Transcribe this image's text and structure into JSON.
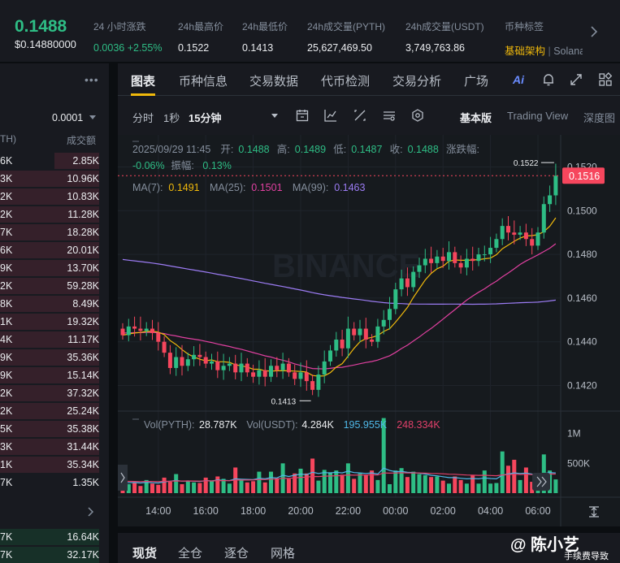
{
  "ticker": {
    "last_price": "0.1488",
    "fiat_price": "$0.14880000",
    "stats": [
      {
        "label": "24 小时涨跌",
        "value": "0.0036 +2.55%",
        "up": true
      },
      {
        "label": "24h最高价",
        "value": "0.1522"
      },
      {
        "label": "24h最低价",
        "value": "0.1413"
      },
      {
        "label": "24h成交量(PYTH)",
        "value": "25,627,469.50"
      },
      {
        "label": "24h成交量(USDT)",
        "value": "3,749,763.86"
      }
    ],
    "tag_label": "币种标签",
    "tag_value": "基础架构",
    "tag_sep": " | ",
    "tag_rest": "Solana"
  },
  "orderbook": {
    "precision": "0.0001",
    "col_left": "TH)",
    "col_right": "成交额",
    "rows": [
      {
        "a": "6K",
        "b": "2.85K",
        "fill": 0.45,
        "side": "ask"
      },
      {
        "a": "3K",
        "b": "10.96K",
        "fill": 1.0,
        "side": "ask"
      },
      {
        "a": "2K",
        "b": "10.83K",
        "fill": 1.0,
        "side": "ask"
      },
      {
        "a": "2K",
        "b": "11.28K",
        "fill": 1.0,
        "side": "ask"
      },
      {
        "a": "7K",
        "b": "18.28K",
        "fill": 1.0,
        "side": "ask"
      },
      {
        "a": "6K",
        "b": "20.01K",
        "fill": 1.0,
        "side": "ask"
      },
      {
        "a": "9K",
        "b": "13.70K",
        "fill": 1.0,
        "side": "ask"
      },
      {
        "a": "2K",
        "b": "59.28K",
        "fill": 1.0,
        "side": "ask"
      },
      {
        "a": "8K",
        "b": "8.49K",
        "fill": 1.0,
        "side": "ask"
      },
      {
        "a": "1K",
        "b": "19.32K",
        "fill": 1.0,
        "side": "ask"
      },
      {
        "a": "4K",
        "b": "11.17K",
        "fill": 1.0,
        "side": "ask"
      },
      {
        "a": "9K",
        "b": "35.36K",
        "fill": 1.0,
        "side": "ask"
      },
      {
        "a": "9K",
        "b": "15.14K",
        "fill": 1.0,
        "side": "ask"
      },
      {
        "a": "2K",
        "b": "37.32K",
        "fill": 1.0,
        "side": "ask"
      },
      {
        "a": "2K",
        "b": "25.24K",
        "fill": 1.0,
        "side": "ask"
      },
      {
        "a": "5K",
        "b": "35.38K",
        "fill": 1.0,
        "side": "ask"
      },
      {
        "a": "3K",
        "b": "31.44K",
        "fill": 1.0,
        "side": "ask"
      },
      {
        "a": "1K",
        "b": "35.34K",
        "fill": 1.0,
        "side": "ask"
      },
      {
        "a": "7K",
        "b": "1.35K",
        "fill": 0.0,
        "side": "ask"
      }
    ],
    "bid_rows": [
      {
        "a": "7K",
        "b": "16.64K",
        "fill": 1.0,
        "side": "bid"
      },
      {
        "a": "7K",
        "b": "32.17K",
        "fill": 1.0,
        "side": "bid"
      }
    ]
  },
  "tabs": [
    {
      "label": "图表",
      "active": true
    },
    {
      "label": "币种信息"
    },
    {
      "label": "交易数据"
    },
    {
      "label": "代币检测"
    },
    {
      "label": "交易分析"
    },
    {
      "label": "广场"
    }
  ],
  "ai_label": "Ai",
  "toolbar": {
    "time_label": "分时",
    "sec_label": "1秒",
    "interval_label": "15分钟",
    "basic_label": "基本版",
    "tv_label": "Trading View",
    "depth_label": "深度图"
  },
  "chart_data": {
    "type": "candlestick",
    "info_line1": {
      "datetime": "2025/09/29 11:45",
      "open_label": "开:",
      "open": "0.1488",
      "high_label": "高:",
      "high": "0.1489",
      "low_label": "低:",
      "low": "0.1487",
      "close_label": "收:",
      "close": "0.1488",
      "chg_label": "涨跌幅:"
    },
    "info_line2": {
      "chg": "-0.06%",
      "amp_label": "振幅:",
      "amp": "0.13%"
    },
    "ma_legend": [
      {
        "label": "MA(7):",
        "value": "0.1491",
        "color": "#f0b90b"
      },
      {
        "label": "MA(25):",
        "value": "0.1501",
        "color": "#e040a0"
      },
      {
        "label": "MA(99):",
        "value": "0.1463",
        "color": "#9c7cf4"
      }
    ],
    "y_ticks": [
      "0.1520",
      "0.1500",
      "0.1480",
      "0.1460",
      "0.1440",
      "0.1420"
    ],
    "y_tick_values": [
      0.152,
      0.15,
      0.148,
      0.146,
      0.144,
      0.142
    ],
    "ylim": [
      0.1412,
      0.1528
    ],
    "current_price": "0.1516",
    "current_price_value": 0.1516,
    "high_marker": "0.1522",
    "low_marker": "0.1413",
    "x_ticks": [
      "14:00",
      "16:00",
      "18:00",
      "20:00",
      "22:00",
      "00:00",
      "02:00",
      "04:00",
      "06:00"
    ],
    "x_tick_index": [
      6,
      14,
      22,
      30,
      38,
      46,
      54,
      62,
      70
    ],
    "colors": {
      "up": "#2ebd85",
      "down": "#f6465d",
      "ma7": "#f0b90b",
      "ma25": "#e040a0",
      "ma99": "#9c7cf4",
      "vol_ma1": "#4fb8e8",
      "vol_ma2": "#e0406a"
    },
    "closes": [
      0.1443,
      0.1447,
      0.1446,
      0.1445,
      0.1446,
      0.1444,
      0.144,
      0.1435,
      0.1428,
      0.1433,
      0.1429,
      0.1432,
      0.1434,
      0.1433,
      0.143,
      0.1431,
      0.1427,
      0.1429,
      0.143,
      0.1426,
      0.143,
      0.1426,
      0.1424,
      0.1427,
      0.1424,
      0.1429,
      0.1427,
      0.143,
      0.1426,
      0.1423,
      0.1426,
      0.1422,
      0.1418,
      0.1425,
      0.1431,
      0.1436,
      0.1441,
      0.1437,
      0.1446,
      0.1443,
      0.1446,
      0.1441,
      0.144,
      0.1447,
      0.145,
      0.1455,
      0.1464,
      0.1469,
      0.1465,
      0.1472,
      0.1475,
      0.1478,
      0.1476,
      0.1479,
      0.1477,
      0.1481,
      0.1476,
      0.1474,
      0.1478,
      0.1477,
      0.148,
      0.148,
      0.1483,
      0.1487,
      0.1493,
      0.149,
      0.1489,
      0.149,
      0.1487,
      0.1484,
      0.149,
      0.1503,
      0.1507,
      0.1516
    ],
    "volume": {
      "legend": [
        {
          "label": "Vol(PYTH):",
          "value": "28.787K",
          "color": "#b7bdc6"
        },
        {
          "label": "Vol(USDT):",
          "value": "4.284K",
          "color": "#b7bdc6"
        },
        {
          "label": "",
          "value": "195.955K",
          "color": "#4fb8e8"
        },
        {
          "label": "",
          "value": "248.334K",
          "color": "#e0406a"
        }
      ],
      "y_ticks": [
        "1M",
        "500K"
      ],
      "y_tick_values": [
        1000000,
        500000
      ],
      "ylim": [
        0,
        1350000
      ],
      "values": [
        200000,
        150000,
        180000,
        120000,
        220000,
        160000,
        140000,
        260000,
        190000,
        320000,
        150000,
        200000,
        180000,
        170000,
        260000,
        210000,
        280000,
        240000,
        160000,
        430000,
        230000,
        180000,
        200000,
        360000,
        180000,
        360000,
        250000,
        500000,
        240000,
        330000,
        410000,
        330000,
        580000,
        210000,
        390000,
        350000,
        380000,
        310000,
        500000,
        240000,
        330000,
        300000,
        380000,
        220000,
        1260000,
        150000,
        380000,
        420000,
        270000,
        360000,
        320000,
        300000,
        270000,
        280000,
        210000,
        160000,
        280000,
        220000,
        160000,
        300000,
        160000,
        380000,
        160000,
        170000,
        700000,
        460000,
        560000,
        220000,
        430000,
        190000,
        280000,
        650000,
        380000,
        230000
      ],
      "ma1": [
        180000,
        175000,
        178000,
        170000,
        182000,
        175000,
        170000,
        190000,
        200000,
        215000,
        200000,
        205000,
        200000,
        195000,
        210000,
        205000,
        220000,
        215000,
        210000,
        240000,
        235000,
        230000,
        228000,
        250000,
        240000,
        260000,
        255000,
        300000,
        280000,
        300000,
        320000,
        310000,
        350000,
        330000,
        345000,
        340000,
        350000,
        340000,
        370000,
        345000,
        340000,
        330000,
        340000,
        320000,
        420000,
        380000,
        360000,
        365000,
        350000,
        345000,
        335000,
        320000,
        300000,
        290000,
        275000,
        260000,
        260000,
        250000,
        240000,
        245000,
        240000,
        255000,
        245000,
        240000,
        300000,
        320000,
        340000,
        330000,
        335000,
        320000,
        310000,
        330000,
        345000,
        340000
      ],
      "ma2": [
        200000,
        198000,
        196000,
        194000,
        196000,
        195000,
        193000,
        198000,
        200000,
        205000,
        203000,
        204000,
        203000,
        202000,
        206000,
        205000,
        210000,
        210000,
        209000,
        220000,
        221000,
        220000,
        221000,
        230000,
        228000,
        235000,
        236000,
        250000,
        248000,
        255000,
        265000,
        268000,
        280000,
        278000,
        284000,
        288000,
        292000,
        295000,
        305000,
        302000,
        305000,
        304000,
        308000,
        304000,
        340000,
        335000,
        338000,
        342000,
        338000,
        340000,
        338000,
        336000,
        332000,
        330000,
        325000,
        318000,
        316000,
        310000,
        304000,
        302000,
        298000,
        300000,
        296000,
        292000,
        305000,
        310000,
        318000,
        314000,
        316000,
        312000,
        310000,
        318000,
        322000,
        320000
      ]
    }
  },
  "bottom_tabs": [
    {
      "label": "现货",
      "active": true
    },
    {
      "label": "全仓"
    },
    {
      "label": "逐仓"
    },
    {
      "label": "网格"
    }
  ],
  "watermark": {
    "line1": "@ 陈小艺",
    "line2": "手续费导致"
  }
}
